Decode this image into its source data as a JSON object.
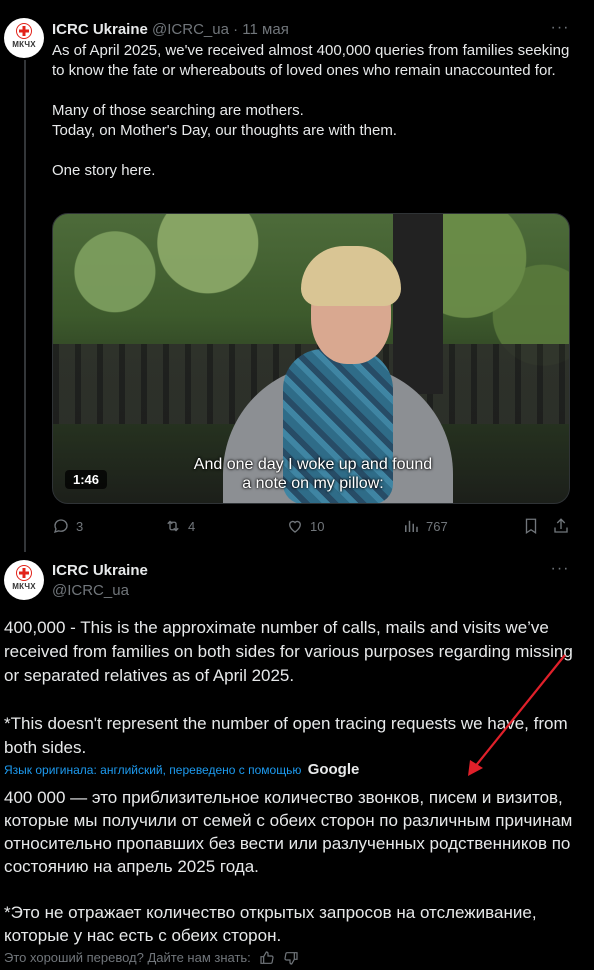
{
  "tweet1": {
    "author_name": "ICRC Ukraine",
    "author_handle": "@ICRC_ua",
    "dot": "·",
    "date": "11 мая",
    "avatar_text": "МКЧХ",
    "paragraphs": [
      "As of April 2025, we've received almost 400,000 queries from families seeking to know the fate or whereabouts of loved ones who remain unaccounted for.",
      "Many of those searching are mothers.",
      "Today, on Mother's Day, our thoughts are with them.",
      "One story here."
    ],
    "video": {
      "duration": "1:46",
      "subtitle_line1": "And one day I woke up and found",
      "subtitle_line2": "a note on my pillow:"
    },
    "stats": {
      "replies": "3",
      "reposts": "4",
      "likes": "10",
      "views": "767"
    }
  },
  "tweet2": {
    "author_name": "ICRC Ukraine",
    "author_handle": "@ICRC_ua",
    "avatar_text": "МКЧХ",
    "original_paragraphs": [
      "400,000 -  This is the approximate number of calls, mails and visits we’ve received from families on both sides for various purposes regarding missing or separated relatives as of April 2025.",
      "*This doesn't represent the number of open tracing requests we have, from both sides."
    ],
    "translation_note": "Язык оригинала: английский, переведено с помощью",
    "translation_provider": "Google",
    "translated_paragraphs": [
      "400 000 — это приблизительное количество звонков, писем и визитов, которые мы получили от семей с обеих сторон по различным причинам относительно пропавших без вести или разлученных родственников по состоянию на апрель 2025 года.",
      "*Это не отражает количество открытых запросов на отслеживание, которые у нас есть с обеих сторон."
    ],
    "feedback_prompt": "Это хороший перевод? Дайте нам знать:"
  },
  "colors": {
    "background": "#000000",
    "text": "#e7e9ea",
    "muted": "#71767b",
    "link": "#1d9bf0",
    "annotation_arrow": "#e0202a",
    "icrc_red": "#e2231a"
  },
  "icons": [
    "more-icon",
    "reply-icon",
    "repost-icon",
    "like-icon",
    "views-icon",
    "bookmark-icon",
    "share-icon",
    "thumbs-up-icon",
    "thumbs-down-icon"
  ]
}
